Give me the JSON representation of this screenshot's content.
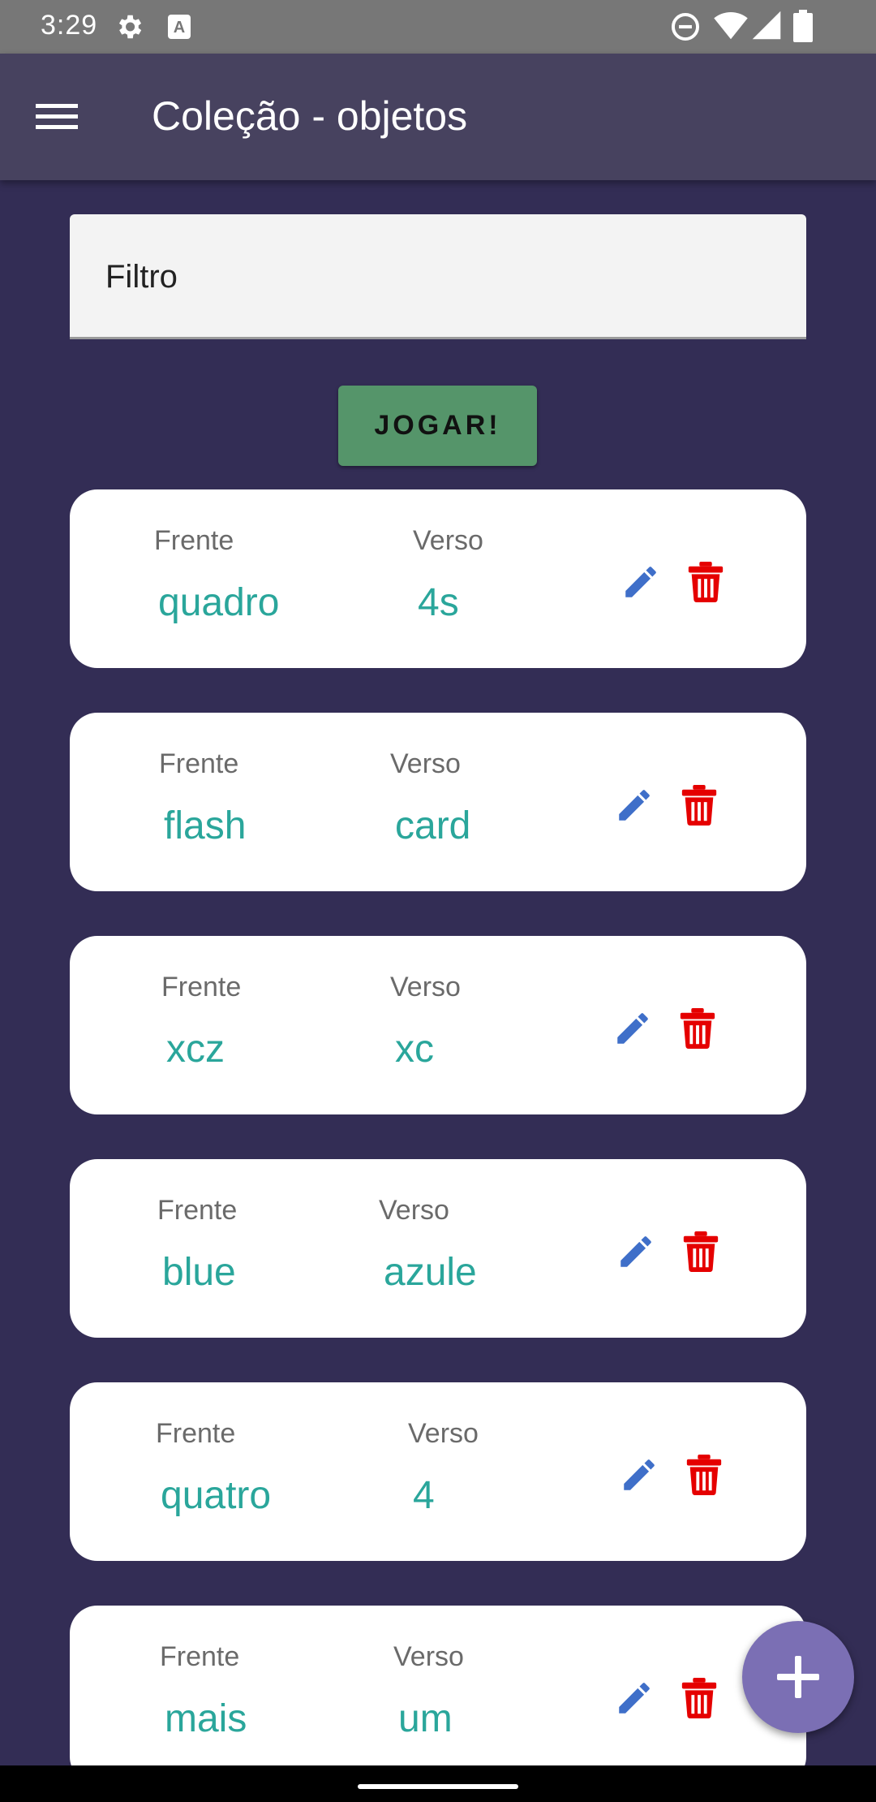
{
  "status_bar": {
    "time": "3:29",
    "left_icons": [
      "gear-icon",
      "a-icon"
    ],
    "right_icons": [
      "dnd-icon",
      "wifi-icon",
      "signal-icon",
      "battery-icon"
    ]
  },
  "app_bar": {
    "title": "Coleção - objetos",
    "menu_icon": "hamburger-menu-icon"
  },
  "filter": {
    "label": "Filtro",
    "value": ""
  },
  "play_button": {
    "label": "JOGAR!"
  },
  "card_labels": {
    "front": "Frente",
    "back": "Verso"
  },
  "cards": [
    {
      "front": "quadro",
      "back": "4s"
    },
    {
      "front": "flash",
      "back": "card"
    },
    {
      "front": "xcz",
      "back": "xc"
    },
    {
      "front": "blue",
      "back": "azule"
    },
    {
      "front": "quatro",
      "back": "4"
    },
    {
      "front": "mais",
      "back": "um"
    }
  ],
  "colors": {
    "background": "#332d55",
    "app_bar": "#47425f",
    "play_button": "#55956a",
    "card_value": "#2aa69b",
    "edit_icon": "#3f6fc9",
    "delete_icon": "#e50000",
    "fab": "#7b6fb4"
  },
  "fab_icon": "plus-icon"
}
